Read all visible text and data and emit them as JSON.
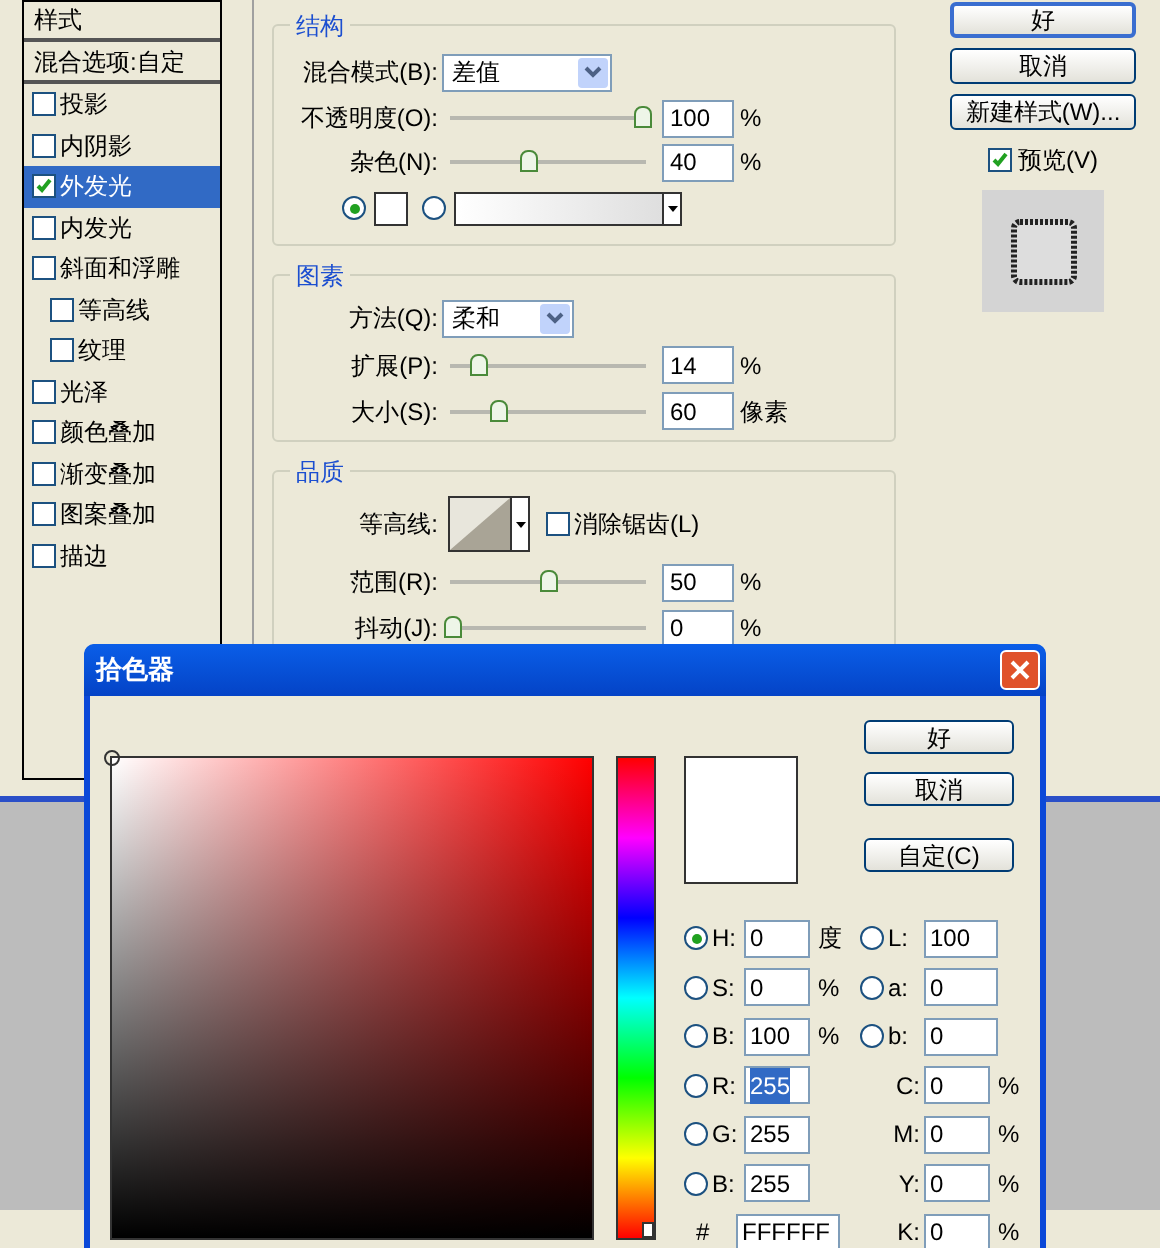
{
  "layer_style": {
    "styles_panel": {
      "header": "样式",
      "blend_options": "混合选项:自定",
      "items": [
        {
          "label": "投影",
          "checked": false,
          "selected": false
        },
        {
          "label": "内阴影",
          "checked": false,
          "selected": false
        },
        {
          "label": "外发光",
          "checked": true,
          "selected": true
        },
        {
          "label": "内发光",
          "checked": false,
          "selected": false
        },
        {
          "label": "斜面和浮雕",
          "checked": false,
          "selected": false,
          "children": [
            {
              "label": "等高线",
              "checked": false,
              "selected": false
            },
            {
              "label": "纹理",
              "checked": false,
              "selected": false
            }
          ]
        },
        {
          "label": "光泽",
          "checked": false,
          "selected": false
        },
        {
          "label": "颜色叠加",
          "checked": false,
          "selected": false
        },
        {
          "label": "渐变叠加",
          "checked": false,
          "selected": false
        },
        {
          "label": "图案叠加",
          "checked": false,
          "selected": false
        },
        {
          "label": "描边",
          "checked": false,
          "selected": false
        }
      ]
    },
    "structure": {
      "title": "结构",
      "blend_mode": {
        "label": "混合模式(B):",
        "value": "差值"
      },
      "opacity": {
        "label": "不透明度(O):",
        "level": 1,
        "value": "100",
        "unit": "%"
      },
      "noise": {
        "label": "杂色(N):",
        "level": 0.4,
        "value": "40",
        "unit": "%"
      },
      "fill_options": [
        {
          "kind": "color",
          "selected": true
        },
        {
          "kind": "gradient",
          "selected": false
        }
      ]
    },
    "elements": {
      "title": "图素",
      "technique": {
        "label": "方法(Q):",
        "value": "柔和"
      },
      "spread": {
        "label": "扩展(P):",
        "level": 0.14,
        "value": "14",
        "unit": "%"
      },
      "size": {
        "label": "大小(S):",
        "level": 0.24,
        "value": "60",
        "unit": "像素"
      }
    },
    "quality": {
      "title": "品质",
      "contour": {
        "label": "等高线:"
      },
      "anti_aliased": {
        "label": "消除锯齿(L)",
        "checked": false
      },
      "range": {
        "label": "范围(R):",
        "level": 0.5,
        "value": "50",
        "unit": "%"
      },
      "jitter": {
        "label": "抖动(J):",
        "level": 0,
        "value": "0",
        "unit": "%"
      }
    },
    "buttons": [
      "好",
      "取消",
      "新建样式(W)..."
    ],
    "preview": {
      "label": "预览(V)",
      "checked": true
    }
  },
  "color_picker": {
    "title": "拾色器",
    "hue_slider": {
      "level": 0
    },
    "buttons": [
      "好",
      "取消",
      "自定(C)"
    ],
    "hsb_rgb": [
      {
        "label": "H:",
        "value": "0",
        "unit": "度",
        "selected": true,
        "focused": false
      },
      {
        "label": "S:",
        "value": "0",
        "unit": "%",
        "selected": false,
        "focused": false
      },
      {
        "label": "B:",
        "value": "100",
        "unit": "%",
        "selected": false,
        "focused": false
      },
      {
        "label": "R:",
        "value": "255",
        "selected": false,
        "focused": true
      },
      {
        "label": "G:",
        "value": "255",
        "selected": false,
        "focused": false
      },
      {
        "label": "B:",
        "value": "255",
        "selected": false,
        "focused": false
      }
    ],
    "lab": [
      {
        "label": "L:",
        "value": "100",
        "selected": false
      },
      {
        "label": "a:",
        "value": "0",
        "selected": false
      },
      {
        "label": "b:",
        "value": "0",
        "selected": false
      }
    ],
    "cmyk": [
      {
        "label": "C:",
        "value": "0",
        "unit": "%"
      },
      {
        "label": "M:",
        "value": "0",
        "unit": "%"
      },
      {
        "label": "Y:",
        "value": "0",
        "unit": "%"
      },
      {
        "label": "K:",
        "value": "0",
        "unit": "%"
      }
    ],
    "hex": {
      "label": "#",
      "value": "FFFFFF"
    }
  }
}
